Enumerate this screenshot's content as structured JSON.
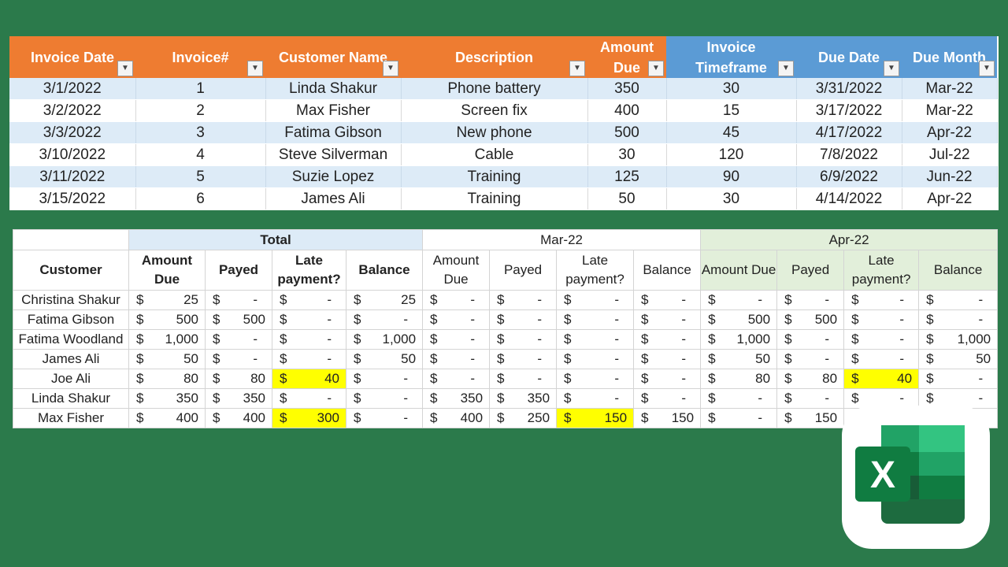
{
  "invoice_table": {
    "headers": [
      {
        "label": "Invoice Date",
        "color": "orange"
      },
      {
        "label": "Invoice#",
        "color": "orange"
      },
      {
        "label": "Customer Name",
        "color": "orange"
      },
      {
        "label": "Description",
        "color": "orange"
      },
      {
        "label": "Amount Due",
        "color": "orange"
      },
      {
        "label": "Invoice Timeframe",
        "color": "blue"
      },
      {
        "label": "Due Date",
        "color": "blue"
      },
      {
        "label": "Due Month",
        "color": "blue"
      }
    ],
    "rows": [
      [
        "3/1/2022",
        "1",
        "Linda Shakur",
        "Phone battery",
        "350",
        "30",
        "3/31/2022",
        "Mar-22"
      ],
      [
        "3/2/2022",
        "2",
        "Max Fisher",
        "Screen fix",
        "400",
        "15",
        "3/17/2022",
        "Mar-22"
      ],
      [
        "3/3/2022",
        "3",
        "Fatima Gibson",
        "New phone",
        "500",
        "45",
        "4/17/2022",
        "Apr-22"
      ],
      [
        "3/10/2022",
        "4",
        "Steve Silverman",
        "Cable",
        "30",
        "120",
        "7/8/2022",
        "Jul-22"
      ],
      [
        "3/11/2022",
        "5",
        "Suzie Lopez",
        "Training",
        "125",
        "90",
        "6/9/2022",
        "Jun-22"
      ],
      [
        "3/15/2022",
        "6",
        "James Ali",
        "Training",
        "50",
        "30",
        "4/14/2022",
        "Apr-22"
      ]
    ]
  },
  "summary_table": {
    "groups": [
      "Total",
      "Mar-22",
      "Apr-22"
    ],
    "customer_header": "Customer",
    "column_headers": [
      "Amount Due",
      "Payed",
      "Late payment?",
      "Balance"
    ],
    "currency": "$",
    "rows": [
      {
        "customer": "Christina Shakur",
        "values": [
          "25",
          "-",
          "-",
          "25",
          "-",
          "-",
          "-",
          "-",
          "-",
          "-",
          "-",
          "-"
        ]
      },
      {
        "customer": "Fatima Gibson",
        "values": [
          "500",
          "500",
          "-",
          "-",
          "-",
          "-",
          "-",
          "-",
          "500",
          "500",
          "-",
          "-"
        ]
      },
      {
        "customer": "Fatima Woodland",
        "values": [
          "1,000",
          "-",
          "-",
          "1,000",
          "-",
          "-",
          "-",
          "-",
          "1,000",
          "-",
          "-",
          "1,000"
        ]
      },
      {
        "customer": "James Ali",
        "values": [
          "50",
          "-",
          "-",
          "50",
          "-",
          "-",
          "-",
          "-",
          "50",
          "-",
          "-",
          "50"
        ]
      },
      {
        "customer": "Joe Ali",
        "values": [
          "80",
          "80",
          "40",
          "-",
          "-",
          "-",
          "-",
          "-",
          "80",
          "80",
          "40",
          "-"
        ],
        "highlight": [
          2,
          10
        ]
      },
      {
        "customer": "Linda Shakur",
        "values": [
          "350",
          "350",
          "-",
          "-",
          "350",
          "350",
          "-",
          "-",
          "-",
          "-",
          "-",
          "-"
        ]
      },
      {
        "customer": "Max Fisher",
        "values": [
          "400",
          "400",
          "300",
          "-",
          "400",
          "250",
          "150",
          "150",
          "-",
          "150",
          "",
          ""
        ],
        "highlight": [
          2,
          6
        ]
      }
    ]
  },
  "colors": {
    "background": "#2b7a4b",
    "orange_header": "#ee7c31",
    "blue_header": "#5b9bd5",
    "row_band": "#ddebf7",
    "highlight": "#ffff00",
    "apr_group": "#e2efda"
  },
  "logo": {
    "letter": "X",
    "icon": "excel-logo-icon"
  }
}
